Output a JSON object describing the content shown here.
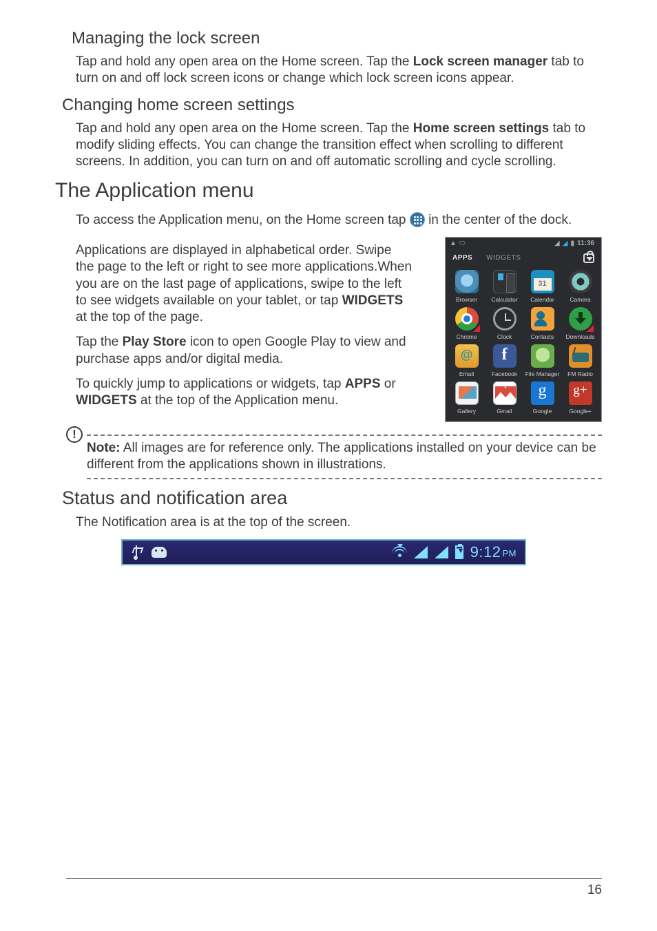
{
  "sections": {
    "managing_lock_title": "Managing the lock screen",
    "managing_lock_p_pre": "Tap and hold any open area on the Home screen. Tap the ",
    "managing_lock_p_bold": "Lock screen manager",
    "managing_lock_p_post": " tab to turn on and off lock screen icons or change which lock screen icons appear.",
    "changing_home_title": "Changing home screen settings",
    "changing_home_p_pre": "Tap and hold any open area on the Home screen. Tap the ",
    "changing_home_p_bold": "Home screen settings",
    "changing_home_p_post": " tab to modify sliding effects. You can change the transition effect when scrolling to different screens. In addition, you can turn on and off automatic scrolling and cycle scrolling.",
    "app_menu_title": "The Application menu",
    "app_access": {
      "pre": "To access the Application menu, on the Home screen tap ",
      "post": " in the center of the dock."
    },
    "app_para2": {
      "pre": "Applications are displayed in alphabetical order. Swipe the page to the left or right to see more applications.When you are on the last page of applications, swipe to the left to see widgets available on your tablet, or tap ",
      "bold": "WIDGETS",
      "post": " at the top of the page."
    },
    "app_para3": {
      "pre": "Tap the ",
      "bold": "Play Store",
      "post": " icon to open Google Play to view and purchase apps and/or digital media."
    },
    "app_para4": {
      "pre": "To quickly jump to applications or widgets, tap ",
      "bold1": "APPS",
      "mid": " or ",
      "bold2": "WIDGETS",
      "post": " at the top of the Application menu."
    },
    "note": {
      "label": "Note:",
      "text": " All images are for reference only. The applications installed on your device can be different from the applications shown in illustrations."
    },
    "status_area_title": "Status and notification area",
    "status_area_p": "The Notification area is at the top of the screen."
  },
  "phone": {
    "status_time": "11:36",
    "tabs": {
      "apps": "APPS",
      "widgets": "WIDGETS"
    },
    "apps": [
      {
        "name": "Browser",
        "icon": "browser"
      },
      {
        "name": "Calculator",
        "icon": "calc"
      },
      {
        "name": "Calendar",
        "icon": "calendar"
      },
      {
        "name": "Camera",
        "icon": "camera"
      },
      {
        "name": "Chrome",
        "icon": "chrome",
        "badge": true
      },
      {
        "name": "Clock",
        "icon": "clock"
      },
      {
        "name": "Contacts",
        "icon": "contacts"
      },
      {
        "name": "Downloads",
        "icon": "downloads",
        "badge": true
      },
      {
        "name": "Email",
        "icon": "email"
      },
      {
        "name": "Facebook",
        "icon": "facebook"
      },
      {
        "name": "File Manager",
        "icon": "filemgr"
      },
      {
        "name": "FM Radio",
        "icon": "fmradio"
      },
      {
        "name": "Gallery",
        "icon": "gallery"
      },
      {
        "name": "Gmail",
        "icon": "gmail"
      },
      {
        "name": "Google",
        "icon": "google"
      },
      {
        "name": "Google+",
        "icon": "googleplus"
      }
    ]
  },
  "statusbar": {
    "time": "9:12",
    "suffix": "PM"
  },
  "page_number": "16"
}
